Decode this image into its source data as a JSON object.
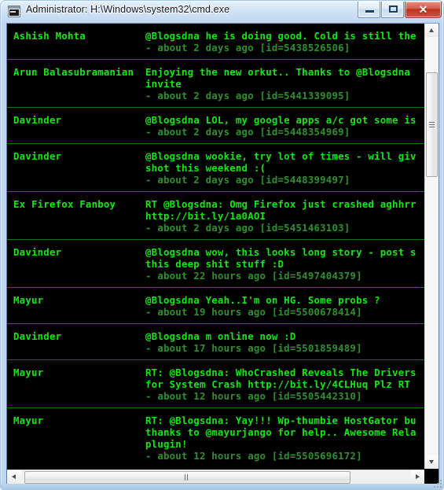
{
  "window": {
    "title": "Administrator: H:\\Windows\\system32\\cmd.exe",
    "icon": "cmd-console-icon",
    "colors": {
      "console_background": "#000000",
      "text_bright_green": "#13e613",
      "text_dim_green": "#2f8f2f",
      "separator_green": "#0a7a0a",
      "frame_blue": "#bcd6ef",
      "close_button_red": "#bc3222"
    },
    "buttons": {
      "minimize": "Minimize",
      "maximize": "Maximize",
      "close": "Close",
      "close_glyph": "✕"
    }
  },
  "scrollbars": {
    "vertical": {
      "up_arrow": "Scroll up",
      "down_arrow": "Scroll down",
      "thumb": "Vertical scroll thumb"
    },
    "horizontal": {
      "left_arrow": "Scroll left",
      "right_arrow": "Scroll right",
      "thumb": "Horizontal scroll thumb"
    },
    "resize_grip": "Resize window"
  },
  "console": {
    "rows": [
      {
        "author": "Ashish Mohta",
        "lines": [
          "@Blogsdna he is doing good. Cold is still the"
        ],
        "meta": "- about 2 days ago [id=5438526506]"
      },
      {
        "author": "Arun Balasubramanian",
        "lines": [
          "Enjoying the new orkut.. Thanks to @Blogsdna",
          "invite"
        ],
        "meta": "- about 2 days ago [id=5441339095]"
      },
      {
        "author": "Davinder",
        "lines": [
          "@Blogsdna LOL, my google apps a/c got some is"
        ],
        "meta": "- about 2 days ago [id=5448354969]"
      },
      {
        "author": "Davinder",
        "lines": [
          "@Blogsdna wookie, try lot of times - will giv",
          "shot this weekend :("
        ],
        "meta": "- about 2 days ago [id=5448399497]"
      },
      {
        "author": "Ex Firefox Fanboy",
        "lines": [
          "RT @Blogsdna: Omg Firefox just crashed aghhrr",
          "http://bit.ly/1a0AOI"
        ],
        "meta": "- about 2 days ago [id=5451463103]"
      },
      {
        "author": "Davinder",
        "lines": [
          "@Blogsdna wow, this looks long story - post s",
          "this deep shit stuff :D"
        ],
        "meta": "- about 22 hours ago [id=5497404379]"
      },
      {
        "author": "Mayur",
        "lines": [
          "@Blogsdna Yeah..I'm on HG. Some probs ?"
        ],
        "meta": "- about 19 hours ago [id=5500678414]"
      },
      {
        "author": "Davinder",
        "lines": [
          "@Blogsdna m online now :D"
        ],
        "meta": "- about 17 hours ago [id=5501859489]"
      },
      {
        "author": "Mayur",
        "lines": [
          "RT: @Blogsdna: WhoCrashed Reveals The Drivers",
          "for System Crash http://bit.ly/4CLHuq Plz RT"
        ],
        "meta": "- about 12 hours ago [id=5505442310]"
      },
      {
        "author": "Mayur",
        "lines": [
          "RT: @Blogsdna: Yay!!! Wp-thumbie HostGator bu",
          "thanks to @mayurjango for help.. Awesome Rela",
          "plugin!"
        ],
        "meta": "- about 12 hours ago [id=5505696172]"
      }
    ]
  }
}
